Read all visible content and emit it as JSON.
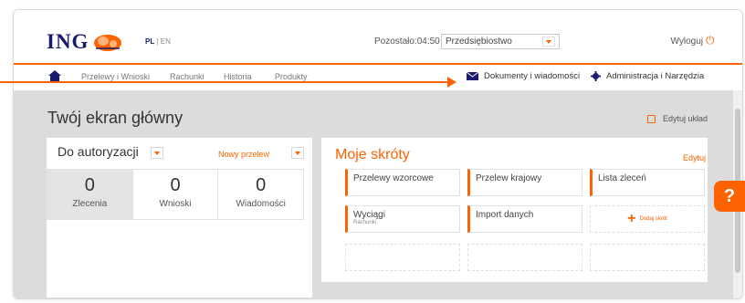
{
  "header": {
    "brand": "ING",
    "lang_active": "PL",
    "lang_sep": "|",
    "lang_other": "EN",
    "timer": "Pozostało:04:50",
    "company_select": "Przedsiębiostwo",
    "logout": "Wyloguj"
  },
  "nav": {
    "items": [
      "Przelewy i Wnioski",
      "Rachunki",
      "Historia",
      "Produkty"
    ],
    "documents": "Dokumenty i wiadomości",
    "admin": "Administracja i Narzędzia"
  },
  "main": {
    "title": "Twój ekran główny",
    "edit_layout": "Edytuj układ"
  },
  "authorization": {
    "title": "Do autoryzacji",
    "new_transfer": "Nowy przelew",
    "counters": [
      {
        "value": "0",
        "label": "Zlecenia"
      },
      {
        "value": "0",
        "label": "Wnioski"
      },
      {
        "value": "0",
        "label": "Wiadomości"
      }
    ]
  },
  "shortcuts": {
    "title": "Moje skróty",
    "edit": "Edytuj",
    "tiles": [
      {
        "label": "Przelewy wzorcowe"
      },
      {
        "label": "Przelew krajowy"
      },
      {
        "label": "Lista zleceń"
      },
      {
        "label": "Wyciągi",
        "sub": "Rachunki"
      },
      {
        "label": "Import danych"
      }
    ],
    "add": "Dodaj skrót"
  },
  "help": "?",
  "colors": {
    "accent": "#ff6200",
    "brand": "#1a1a6e",
    "background": "#dcdcdc"
  }
}
